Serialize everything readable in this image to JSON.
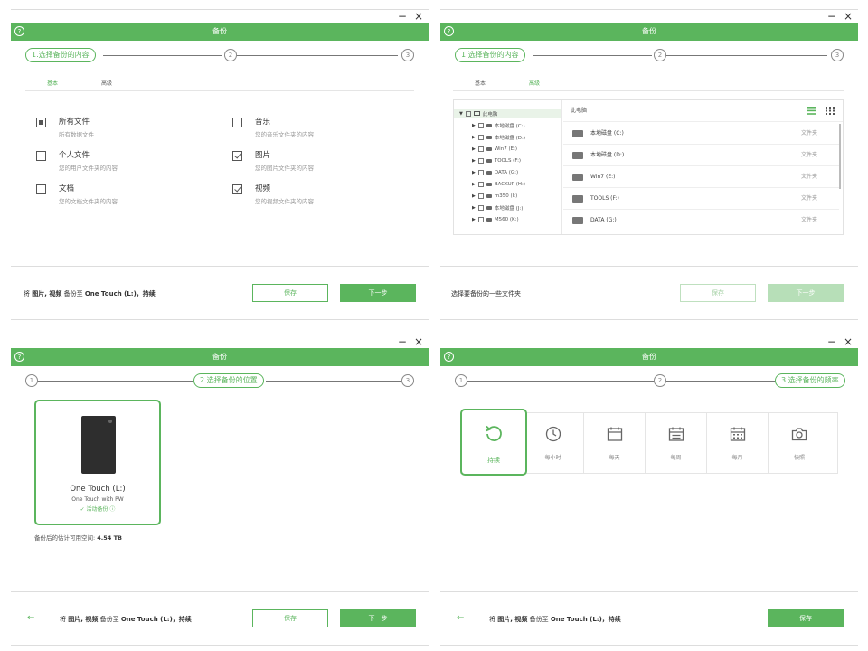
{
  "window_controls": {
    "minimize": "−",
    "close": "×"
  },
  "app_title": "备份",
  "help_icon_label": "?",
  "steps": {
    "step1_label": "1.选择备份的内容",
    "step1_num": "1",
    "step2_label": "2.选择备份的位置",
    "step2_num": "2",
    "step3_label": "3.选择备份的频率",
    "step3_num": "3"
  },
  "tabs": {
    "basic": "基本",
    "advanced": "高级"
  },
  "options": [
    {
      "title": "所有文件",
      "desc": "所有数据文件",
      "state": "partial"
    },
    {
      "title": "音乐",
      "desc": "您的音乐文件夹的内容",
      "state": "unchecked"
    },
    {
      "title": "个人文件",
      "desc": "您的用户文件夹的内容",
      "state": "unchecked"
    },
    {
      "title": "图片",
      "desc": "您的图片文件夹的内容",
      "state": "checked"
    },
    {
      "title": "文档",
      "desc": "您的文档文件夹的内容",
      "state": "unchecked"
    },
    {
      "title": "视频",
      "desc": "您的视频文件夹的内容",
      "state": "checked"
    }
  ],
  "summary": {
    "prefix": "将",
    "items": "图片, 视频",
    "middle": "备份至",
    "target": "One Touch (L:)",
    "freq": "持续",
    "sep": "，"
  },
  "buttons": {
    "save": "保存",
    "next": "下一步",
    "back": "←"
  },
  "panel2": {
    "footer": "选择要备份的一些文件夹",
    "tree_root": "此电脑",
    "tree_items": [
      "本地磁盘 (C:)",
      "本地磁盘 (D:)",
      "Win7 (E:)",
      "TOOLS (F:)",
      "DATA (G:)",
      "BACKUP (H:)",
      "m350 (I:)",
      "本地磁盘 (J:)",
      "M560 (K:)"
    ],
    "list_header": "此电脑",
    "list_items": [
      {
        "name": "本地磁盘 (C:)",
        "type": "文件夹"
      },
      {
        "name": "本地磁盘 (D:)",
        "type": "文件夹"
      },
      {
        "name": "Win7 (E:)",
        "type": "文件夹"
      },
      {
        "name": "TOOLS (F:)",
        "type": "文件夹"
      },
      {
        "name": "DATA (G:)",
        "type": "文件夹"
      }
    ]
  },
  "panel3": {
    "drive_name": "One Touch (L:)",
    "drive_model": "One Touch with PW",
    "drive_status": "✓ 活动备份 ⓘ",
    "space_label": "备份后的估计可用空间: ",
    "space_value": "4.54 TB"
  },
  "panel4": {
    "frequencies": [
      "持续",
      "每小时",
      "每天",
      "每周",
      "每月",
      "快照"
    ]
  },
  "colors": {
    "accent": "#5bb55d"
  }
}
